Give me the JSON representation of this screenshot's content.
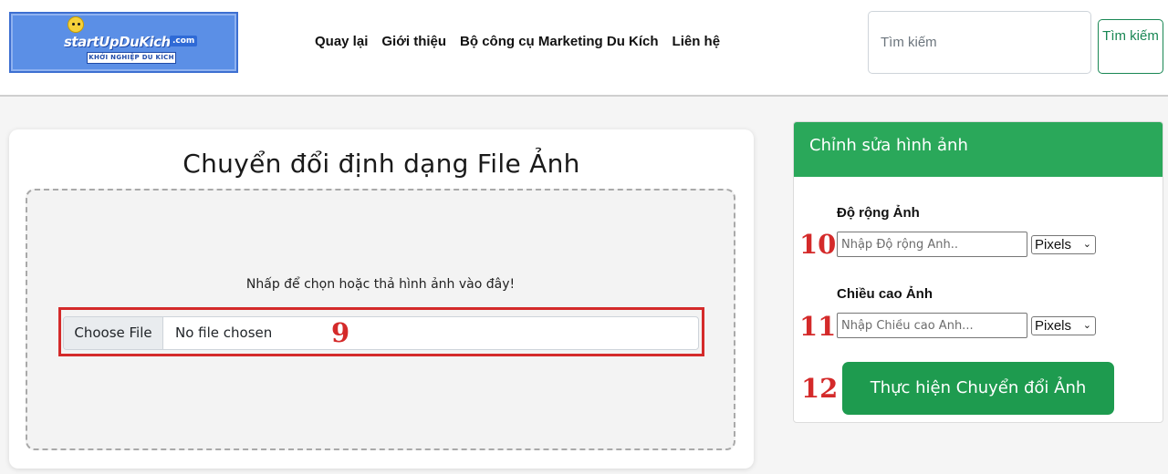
{
  "logo": {
    "brand": "startUpDuKich",
    "dotcom": ".com",
    "tagline": "KHỞI NGHIỆP DU KÍCH"
  },
  "nav": {
    "items": [
      {
        "label": "Quay lại"
      },
      {
        "label": "Giới thiệu"
      },
      {
        "label": "Bộ công cụ Marketing Du Kích"
      },
      {
        "label": "Liên hệ"
      }
    ]
  },
  "search": {
    "placeholder": "Tìm kiếm",
    "button_label": "Tìm kiếm"
  },
  "main": {
    "title": "Chuyển đổi định dạng File Ảnh",
    "drop_hint": "Nhấp để chọn hoặc thả hình ảnh vào đây!",
    "file_button": "Choose File",
    "file_status": "No file chosen"
  },
  "side": {
    "title": "Chỉnh sửa hình ảnh",
    "width_label": "Độ rộng Ảnh",
    "width_placeholder": "Nhập Độ rộng Ảnh..",
    "height_label": "Chiều cao Ảnh",
    "height_placeholder": "Nhập Chiều cao Ảnh...",
    "unit_selected": "Pixels",
    "convert_label": "Thực hiện Chuyển đổi Ảnh"
  },
  "markers": {
    "file": "9",
    "width": "10",
    "height": "11",
    "convert": "12"
  },
  "colors": {
    "accent_green": "#2aa85a",
    "button_green": "#1e9b4f",
    "marker_red": "#d42a2a"
  },
  "icons": {
    "select_arrow": "chevron-down-icon",
    "logo_mascot": "mascot-icon"
  }
}
